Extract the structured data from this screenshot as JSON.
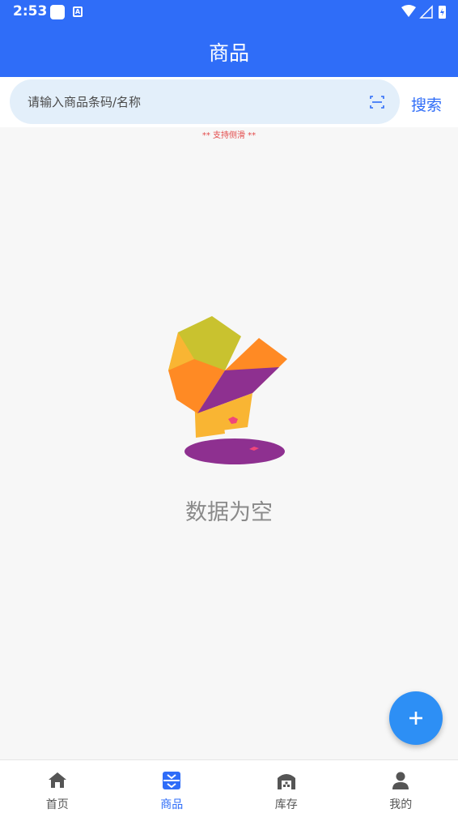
{
  "status_bar": {
    "time": "2:53",
    "badge_letter": "A"
  },
  "header": {
    "title": "商品"
  },
  "search": {
    "placeholder": "请输入商品条码/名称",
    "button_label": "搜索",
    "scan_icon": "scan-icon"
  },
  "hint": "** 支持侧滑 **",
  "empty_state": {
    "text": "数据为空",
    "illustration": "empty-box-illustration"
  },
  "fab": {
    "icon": "plus-icon"
  },
  "bottom_nav": {
    "items": [
      {
        "label": "首页",
        "icon": "home-icon",
        "active": false
      },
      {
        "label": "商品",
        "icon": "product-icon",
        "active": true
      },
      {
        "label": "库存",
        "icon": "warehouse-icon",
        "active": false
      },
      {
        "label": "我的",
        "icon": "user-icon",
        "active": false
      }
    ]
  },
  "colors": {
    "primary": "#2f6df8",
    "fab": "#2d8ff5",
    "hint": "#e34b4b",
    "search_bg": "#e3effa"
  }
}
